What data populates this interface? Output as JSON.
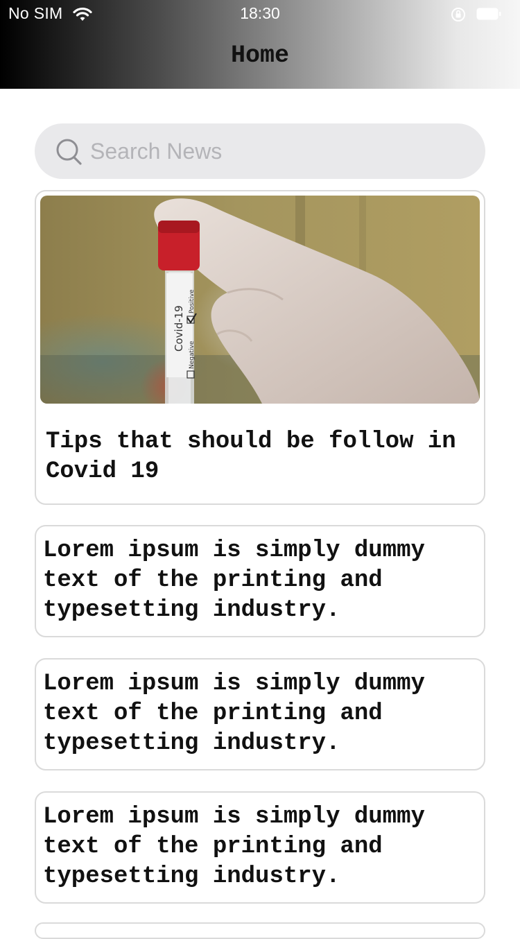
{
  "status_bar": {
    "carrier": "No SIM",
    "time": "18:30"
  },
  "nav": {
    "title": "Home"
  },
  "search": {
    "placeholder": "Search News",
    "icon": "search-icon"
  },
  "featured": {
    "title": "Tips that should be follow in Covid 19",
    "image": {
      "tube_cap_color": "#c8202a",
      "tube_label": "Covid-19",
      "checkbox_positive": "Positive",
      "checkbox_negative": "Negative"
    }
  },
  "articles": [
    {
      "text": "Lorem ipsum is simply dummy text of the printing and typesetting industry."
    },
    {
      "text": "Lorem ipsum is simply dummy text of the printing and typesetting industry."
    },
    {
      "text": "Lorem ipsum is simply dummy text of the printing and typesetting industry."
    }
  ]
}
